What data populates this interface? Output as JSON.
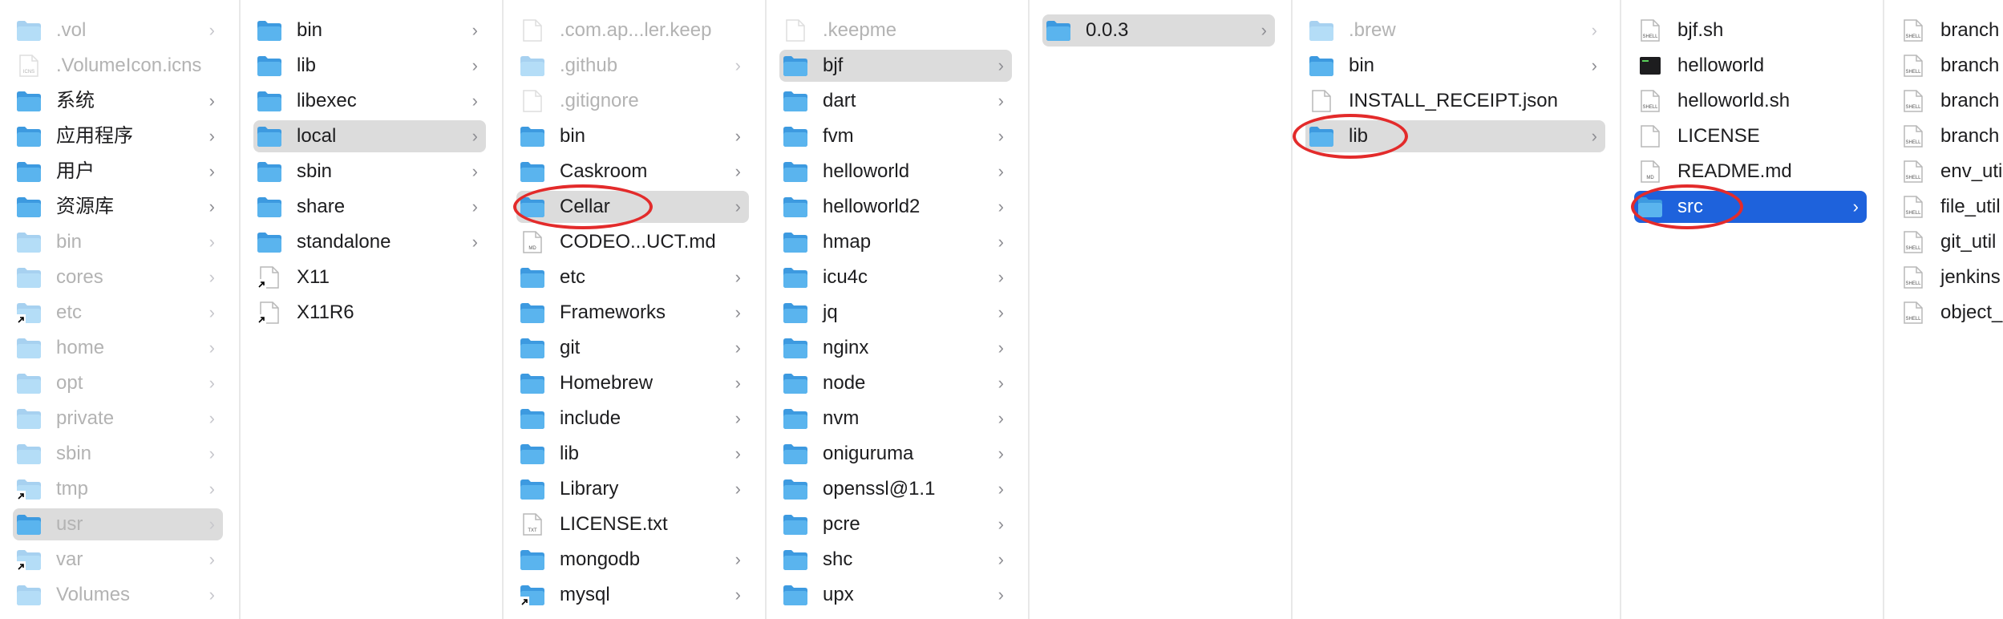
{
  "columns": [
    {
      "items": [
        {
          "label": ".vol",
          "icon": "folder",
          "chevron": true,
          "state": "dim"
        },
        {
          "label": ".VolumeIcon.icns",
          "icon": "icns-file",
          "chevron": false,
          "state": "dim"
        },
        {
          "label": "系统",
          "icon": "folder-system",
          "chevron": true,
          "state": "normal"
        },
        {
          "label": "应用程序",
          "icon": "folder-apps",
          "chevron": true,
          "state": "normal"
        },
        {
          "label": "用户",
          "icon": "folder-users",
          "chevron": true,
          "state": "normal"
        },
        {
          "label": "资源库",
          "icon": "folder-library",
          "chevron": true,
          "state": "normal"
        },
        {
          "label": "bin",
          "icon": "folder",
          "chevron": true,
          "state": "dim"
        },
        {
          "label": "cores",
          "icon": "folder",
          "chevron": true,
          "state": "dim"
        },
        {
          "label": "etc",
          "icon": "alias-folder",
          "chevron": true,
          "state": "dim"
        },
        {
          "label": "home",
          "icon": "folder-home",
          "chevron": true,
          "state": "dim"
        },
        {
          "label": "opt",
          "icon": "folder",
          "chevron": true,
          "state": "dim"
        },
        {
          "label": "private",
          "icon": "folder",
          "chevron": true,
          "state": "dim"
        },
        {
          "label": "sbin",
          "icon": "folder",
          "chevron": true,
          "state": "dim"
        },
        {
          "label": "tmp",
          "icon": "alias-folder",
          "chevron": true,
          "state": "dim"
        },
        {
          "label": "usr",
          "icon": "folder",
          "chevron": true,
          "state": "dim-selected"
        },
        {
          "label": "var",
          "icon": "alias-folder",
          "chevron": true,
          "state": "dim"
        },
        {
          "label": "Volumes",
          "icon": "folder",
          "chevron": true,
          "state": "dim"
        }
      ]
    },
    {
      "items": [
        {
          "label": "bin",
          "icon": "folder",
          "chevron": true,
          "state": "normal"
        },
        {
          "label": "lib",
          "icon": "folder",
          "chevron": true,
          "state": "normal"
        },
        {
          "label": "libexec",
          "icon": "folder",
          "chevron": true,
          "state": "normal"
        },
        {
          "label": "local",
          "icon": "folder",
          "chevron": true,
          "state": "selected"
        },
        {
          "label": "sbin",
          "icon": "folder",
          "chevron": true,
          "state": "normal"
        },
        {
          "label": "share",
          "icon": "folder",
          "chevron": true,
          "state": "normal"
        },
        {
          "label": "standalone",
          "icon": "folder",
          "chevron": true,
          "state": "normal"
        },
        {
          "label": "X11",
          "icon": "alias-file",
          "chevron": false,
          "state": "normal"
        },
        {
          "label": "X11R6",
          "icon": "alias-file",
          "chevron": false,
          "state": "normal"
        }
      ]
    },
    {
      "items": [
        {
          "label": ".com.ap...ler.keep",
          "icon": "file",
          "chevron": false,
          "state": "dim"
        },
        {
          "label": ".github",
          "icon": "folder",
          "chevron": true,
          "state": "dim"
        },
        {
          "label": ".gitignore",
          "icon": "file",
          "chevron": false,
          "state": "dim"
        },
        {
          "label": "bin",
          "icon": "folder",
          "chevron": true,
          "state": "normal"
        },
        {
          "label": "Caskroom",
          "icon": "folder",
          "chevron": true,
          "state": "normal"
        },
        {
          "label": "Cellar",
          "icon": "folder",
          "chevron": true,
          "state": "selected"
        },
        {
          "label": "CODEO...UCT.md",
          "icon": "md-file",
          "chevron": false,
          "state": "normal"
        },
        {
          "label": "etc",
          "icon": "folder",
          "chevron": true,
          "state": "normal"
        },
        {
          "label": "Frameworks",
          "icon": "folder",
          "chevron": true,
          "state": "normal"
        },
        {
          "label": "git",
          "icon": "folder",
          "chevron": true,
          "state": "normal"
        },
        {
          "label": "Homebrew",
          "icon": "folder",
          "chevron": true,
          "state": "normal"
        },
        {
          "label": "include",
          "icon": "folder",
          "chevron": true,
          "state": "normal"
        },
        {
          "label": "lib",
          "icon": "folder",
          "chevron": true,
          "state": "normal"
        },
        {
          "label": "Library",
          "icon": "folder",
          "chevron": true,
          "state": "normal"
        },
        {
          "label": "LICENSE.txt",
          "icon": "txt-file",
          "chevron": false,
          "state": "normal"
        },
        {
          "label": "mongodb",
          "icon": "folder",
          "chevron": true,
          "state": "normal"
        },
        {
          "label": "mysql",
          "icon": "alias-folder",
          "chevron": true,
          "state": "normal"
        }
      ]
    },
    {
      "items": [
        {
          "label": ".keepme",
          "icon": "file",
          "chevron": false,
          "state": "dim"
        },
        {
          "label": "bjf",
          "icon": "folder",
          "chevron": true,
          "state": "selected"
        },
        {
          "label": "dart",
          "icon": "folder",
          "chevron": true,
          "state": "normal"
        },
        {
          "label": "fvm",
          "icon": "folder",
          "chevron": true,
          "state": "normal"
        },
        {
          "label": "helloworld",
          "icon": "folder",
          "chevron": true,
          "state": "normal"
        },
        {
          "label": "helloworld2",
          "icon": "folder",
          "chevron": true,
          "state": "normal"
        },
        {
          "label": "hmap",
          "icon": "folder",
          "chevron": true,
          "state": "normal"
        },
        {
          "label": "icu4c",
          "icon": "folder",
          "chevron": true,
          "state": "normal"
        },
        {
          "label": "jq",
          "icon": "folder",
          "chevron": true,
          "state": "normal"
        },
        {
          "label": "nginx",
          "icon": "folder",
          "chevron": true,
          "state": "normal"
        },
        {
          "label": "node",
          "icon": "folder",
          "chevron": true,
          "state": "normal"
        },
        {
          "label": "nvm",
          "icon": "folder",
          "chevron": true,
          "state": "normal"
        },
        {
          "label": "oniguruma",
          "icon": "folder",
          "chevron": true,
          "state": "normal"
        },
        {
          "label": "openssl@1.1",
          "icon": "folder",
          "chevron": true,
          "state": "normal"
        },
        {
          "label": "pcre",
          "icon": "folder",
          "chevron": true,
          "state": "normal"
        },
        {
          "label": "shc",
          "icon": "folder",
          "chevron": true,
          "state": "normal"
        },
        {
          "label": "upx",
          "icon": "folder",
          "chevron": true,
          "state": "normal"
        }
      ]
    },
    {
      "items": [
        {
          "label": "0.0.3",
          "icon": "folder",
          "chevron": true,
          "state": "selected"
        }
      ]
    },
    {
      "items": [
        {
          "label": ".brew",
          "icon": "folder",
          "chevron": true,
          "state": "dim"
        },
        {
          "label": "bin",
          "icon": "folder",
          "chevron": true,
          "state": "normal"
        },
        {
          "label": "INSTALL_RECEIPT.json",
          "icon": "file",
          "chevron": false,
          "state": "normal"
        },
        {
          "label": "lib",
          "icon": "folder",
          "chevron": true,
          "state": "selected"
        }
      ]
    },
    {
      "items": [
        {
          "label": "bjf.sh",
          "icon": "shell-file",
          "chevron": false,
          "state": "normal"
        },
        {
          "label": "helloworld",
          "icon": "exec-file",
          "chevron": false,
          "state": "normal"
        },
        {
          "label": "helloworld.sh",
          "icon": "shell-file",
          "chevron": false,
          "state": "normal"
        },
        {
          "label": "LICENSE",
          "icon": "file",
          "chevron": false,
          "state": "normal"
        },
        {
          "label": "README.md",
          "icon": "md-file",
          "chevron": false,
          "state": "normal"
        },
        {
          "label": "src",
          "icon": "folder",
          "chevron": true,
          "state": "active"
        }
      ]
    },
    {
      "items": [
        {
          "label": "branch",
          "icon": "shell-file",
          "chevron": false,
          "state": "normal"
        },
        {
          "label": "branch",
          "icon": "shell-file",
          "chevron": false,
          "state": "normal"
        },
        {
          "label": "branch",
          "icon": "shell-file",
          "chevron": false,
          "state": "normal"
        },
        {
          "label": "branch",
          "icon": "shell-file",
          "chevron": false,
          "state": "normal"
        },
        {
          "label": "env_uti",
          "icon": "shell-file",
          "chevron": false,
          "state": "normal"
        },
        {
          "label": "file_util",
          "icon": "shell-file",
          "chevron": false,
          "state": "normal"
        },
        {
          "label": "git_util",
          "icon": "shell-file",
          "chevron": false,
          "state": "normal"
        },
        {
          "label": "jenkins",
          "icon": "shell-file",
          "chevron": false,
          "state": "normal"
        },
        {
          "label": "object_",
          "icon": "shell-file",
          "chevron": false,
          "state": "normal"
        }
      ]
    }
  ],
  "annotations": [
    {
      "target": "Cellar",
      "color": "#e32b2b"
    },
    {
      "target": "lib",
      "color": "#e32b2b"
    },
    {
      "target": "src",
      "color": "#e32b2b"
    }
  ],
  "colors": {
    "folder": "#5ab4ee",
    "folder_dark": "#3d9ae0",
    "selection": "#dcdcdc",
    "active": "#1e62dc",
    "dim_text": "#b3b3b3"
  }
}
